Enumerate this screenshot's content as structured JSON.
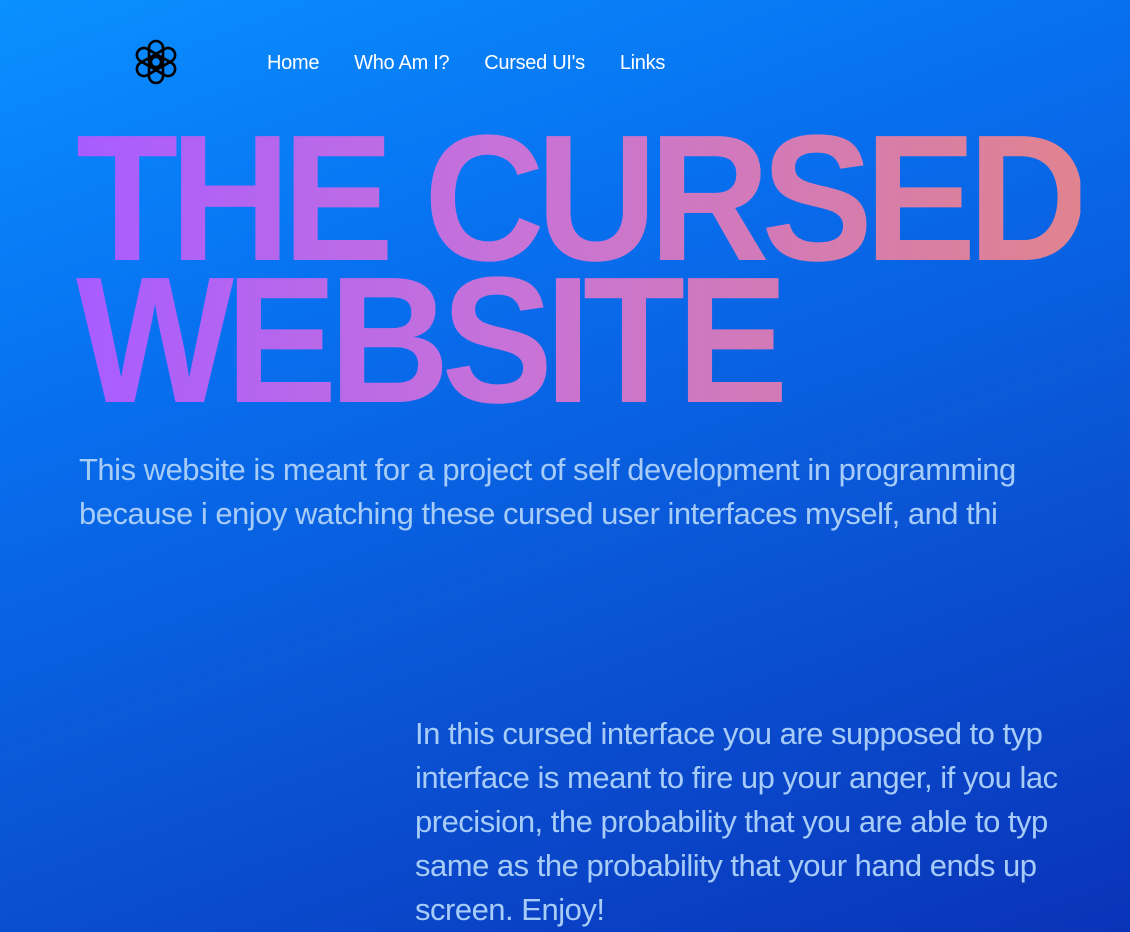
{
  "logo": {
    "icon": "openai-knot-icon",
    "color": "#000000"
  },
  "nav": {
    "items": [
      {
        "label": "Home"
      },
      {
        "label": "Who Am I?"
      },
      {
        "label": "Cursed UI's"
      },
      {
        "label": "Links"
      }
    ]
  },
  "hero": {
    "title_line1": "THE CURSED",
    "title_line2": "WEBSITE",
    "gradient_colors": [
      "#a85cff",
      "#e0838f"
    ]
  },
  "intro": {
    "line1": "This website is meant for a project of self development in programming",
    "line2": "because i enjoy watching these cursed user interfaces myself, and thi"
  },
  "description": {
    "line1": "In this cursed interface you are supposed to typ",
    "line2": "interface is meant to fire up your anger, if you lac",
    "line3": "precision, the probability that you are able to typ",
    "line4": "same as the probability that your hand ends up",
    "line5": "screen. Enjoy!"
  },
  "colors": {
    "background_top": "#0a90ff",
    "background_bottom": "#0a33b8",
    "body_text": "#a6ccf7"
  }
}
